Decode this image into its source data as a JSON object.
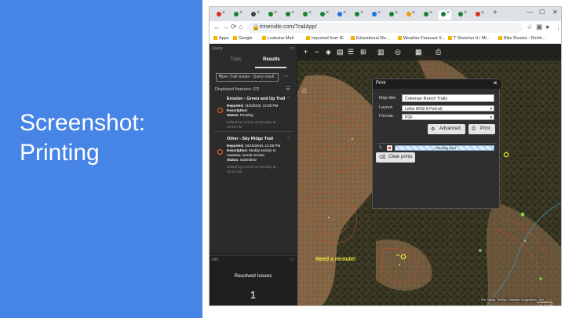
{
  "slide": {
    "title_line1": "Screenshot:",
    "title_line2": "Printing",
    "colors": {
      "left_panel": "#4684e6",
      "slide_bg": "#ffffff"
    }
  },
  "browser": {
    "url": "trinerville.com/TrailApp/",
    "tab_favicon_colors": [
      "#d93025",
      "#188038",
      "#3c4043",
      "#188038",
      "#188038",
      "#188038",
      "#188038",
      "#1a73e8",
      "#188038",
      "#1a73e8",
      "#188038",
      "#f29900",
      "#188038",
      "#188038",
      "#188038",
      "#d93025"
    ],
    "bookmarks": [
      "Apps",
      "Google",
      "Lodestar Mail",
      "Imported from IE",
      "Educational Ris...",
      "Weather Forecast S...",
      "T Sketcher It / Mt...",
      "Bike Routes - Richh..."
    ],
    "icons": {
      "back": "arrow-left-icon",
      "forward": "arrow-right-icon",
      "reload": "reload-icon",
      "home": "home-icon",
      "lock": "lock-icon"
    }
  },
  "issues_widget": {
    "header": "Query",
    "tabs": [
      "Trails",
      "Results"
    ],
    "selected_tab": "Results",
    "dropdown_value": "Open Trail Issues - Query result",
    "displayed_features": "Displayed features: 2/2",
    "issues": [
      {
        "title": "Erosion - Green and Up Trail",
        "reported_label": "Reported:",
        "reported": "11/5/2019, 12:00 PM",
        "description_label": "Description:",
        "description": "",
        "status_label": "Status:",
        "status": "Pending",
        "edited": "Edited by Lenore at Monday at",
        "edited_time": "10:16 AM"
      },
      {
        "title": "Other - Sky Ridge Trail",
        "reported_label": "Reported:",
        "reported": "10/18/2019, 12:39 PM",
        "description_label": "Description:",
        "description": "Muddy section in",
        "description_2": "meadow, needs reroute",
        "status_label": "Status:",
        "status": "Submitted",
        "edited": "Edited by Lenore at Monday at",
        "edited_time": "10:16 AM"
      }
    ]
  },
  "summary_widget": {
    "header": "Info",
    "label": "Resolved Issues",
    "count": "1"
  },
  "print_dialog": {
    "title": "Print",
    "map_title_label": "Map title:",
    "map_title_value": "Coleman Ranch Trails",
    "layout_label": "Layout:",
    "layout_value": "Letter ANSI A Portrait",
    "format_label": "Format:",
    "format_value": "PDF",
    "advanced_label": "Advanced",
    "print_label": "Print",
    "job_number": "1.",
    "job_status": "Creating print",
    "clear_label": "Clear prints"
  },
  "map": {
    "callout": "Need a reroute!",
    "logo_top": "POWERED BY",
    "logo": "esri",
    "attribution": "Esri, Maxar, GeoEye, Earthstar Geographics | Esri"
  }
}
